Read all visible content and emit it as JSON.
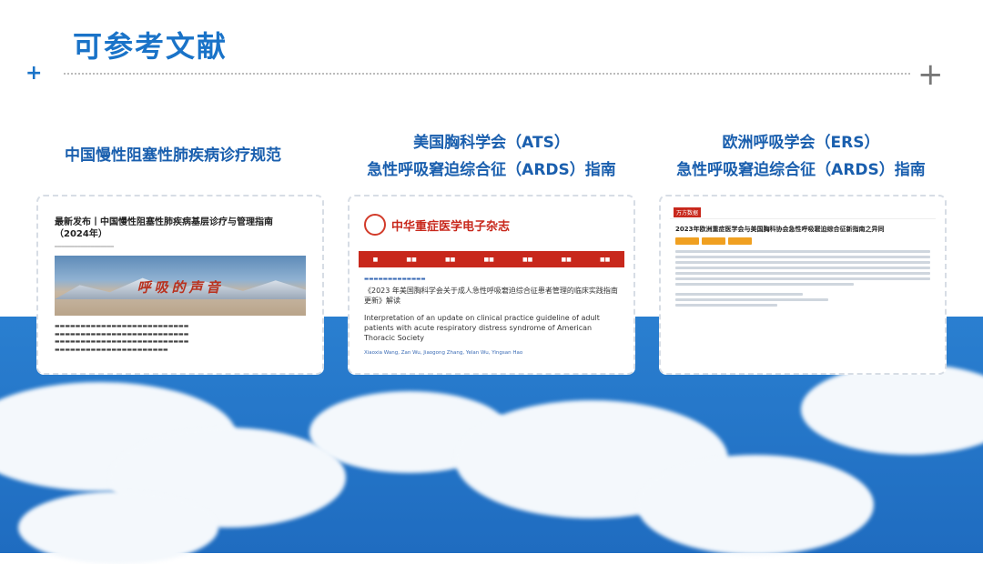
{
  "page_title": "可参考文献",
  "cards": [
    {
      "caption_lines": [
        "中国慢性阻塞性肺疾病诊疗规范"
      ],
      "heading": "最新发布丨中国慢性阻塞性肺疾病基层诊疗与管理指南（2024年）",
      "banner_text": "呼吸的声音"
    },
    {
      "caption_lines": [
        "美国胸科学会（ATS）",
        "急性呼吸窘迫综合征（ARDS）指南"
      ],
      "journal_name": "中华重症医学电子杂志",
      "zh_title": "《2023 年美国胸科学会关于成人急性呼吸窘迫综合征患者管理的临床实践指南更新》解读",
      "en_title": "Interpretation of an update on clinical practice guideline of adult patients with acute respiratory distress syndrome of American Thoracic Society",
      "authors": "Xiaoxia Wang, Zan Wu, Jiaogong Zhang, Yelan Wu, Yingsan Hao"
    },
    {
      "caption_lines": [
        "欧洲呼吸学会（ERS）",
        "急性呼吸窘迫综合征（ARDS）指南"
      ],
      "brand": "万方数据",
      "title": "2023年欧洲重症医学会与美国胸科协会急性呼吸窘迫综合征新指南之异同"
    }
  ]
}
